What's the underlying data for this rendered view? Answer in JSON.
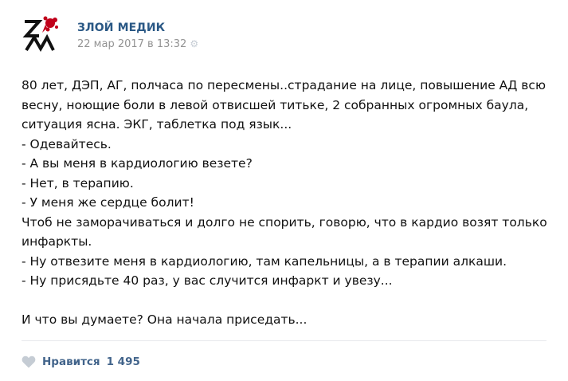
{
  "post": {
    "author": "ЗЛОЙ МЕДИК",
    "date": "22 мар 2017 в 13:32",
    "lines": [
      "80 лет, ДЭП, АГ, полчаса по пересмены..страдание на лице, повышение АД всю",
      "весну, ноющие боли в левой отвисшей титьке, 2 собранных огромных баула,",
      "ситуация ясна. ЭКГ, таблетка под язык...",
      "- Одевайтесь.",
      "- А вы меня в кардиологию везете?",
      "- Нет, в терапию.",
      "- У меня же сердце болит!",
      "Чтоб не заморачиваться и долго не спорить, говорю, что в кардио возят только",
      "инфаркты.",
      "- Ну отвезите меня в кардиологию, там капельницы, а в терапии алкаши.",
      "- Ну присядьте 40 раз, у вас случится инфаркт и увезу..."
    ],
    "final_line": "И что вы думаете? Она начала приседать..."
  },
  "footer": {
    "like_label": "Нравится",
    "like_count": "1 495"
  },
  "icons": {
    "avatar": "zm-logo",
    "settings": "gear-icon",
    "like": "heart-icon"
  },
  "colors": {
    "author": "#2a5885",
    "meta": "#939393",
    "like_text": "#42648b",
    "heart": "#c5ccd4",
    "logo_red": "#c0001a"
  }
}
